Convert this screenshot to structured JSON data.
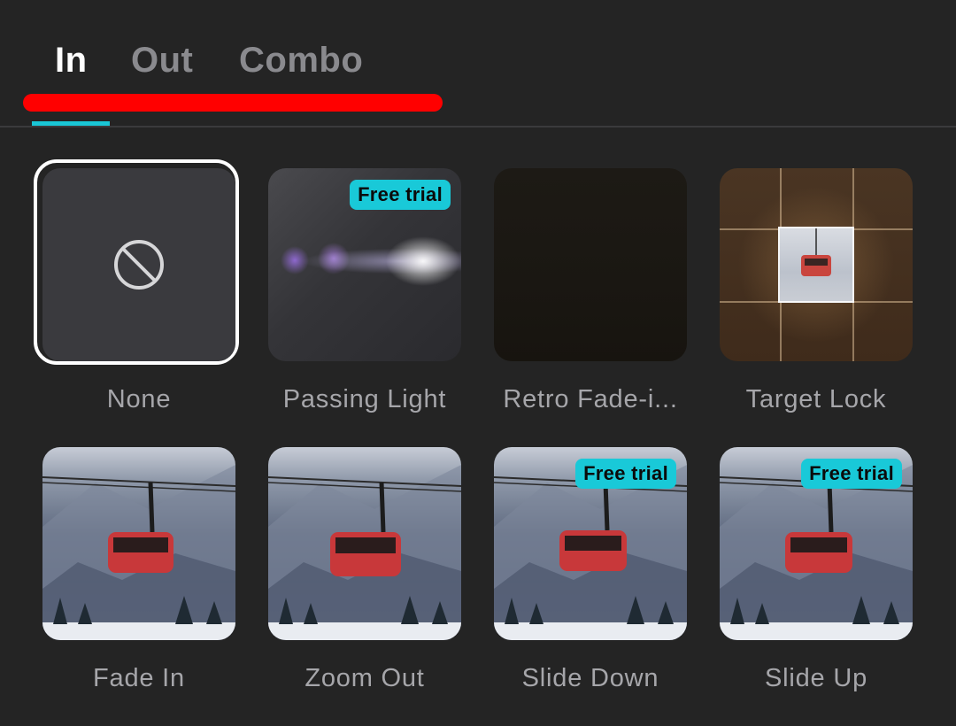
{
  "tabs": [
    {
      "label": "In",
      "active": true
    },
    {
      "label": "Out",
      "active": false
    },
    {
      "label": "Combo",
      "active": false
    }
  ],
  "colors": {
    "background": "#242424",
    "accent": "#19c6d6",
    "badge": "#19c9d8",
    "annotation": "#ff0000",
    "selected_ring": "#ffffff"
  },
  "effects": [
    {
      "label": "None",
      "thumbnail": "none-icon",
      "selected": true,
      "badge": ""
    },
    {
      "label": "Passing Light",
      "thumbnail": "light-streak",
      "selected": false,
      "badge": "Free trial"
    },
    {
      "label": "Retro Fade-i...",
      "thumbnail": "dark-frame",
      "selected": false,
      "badge": ""
    },
    {
      "label": "Target Lock",
      "thumbnail": "target-grid",
      "selected": false,
      "badge": ""
    },
    {
      "label": "Fade In",
      "thumbnail": "gondola",
      "selected": false,
      "badge": ""
    },
    {
      "label": "Zoom Out",
      "thumbnail": "gondola",
      "selected": false,
      "badge": ""
    },
    {
      "label": "Slide Down",
      "thumbnail": "gondola",
      "selected": false,
      "badge": "Free trial"
    },
    {
      "label": "Slide Up",
      "thumbnail": "gondola",
      "selected": false,
      "badge": "Free trial"
    }
  ]
}
